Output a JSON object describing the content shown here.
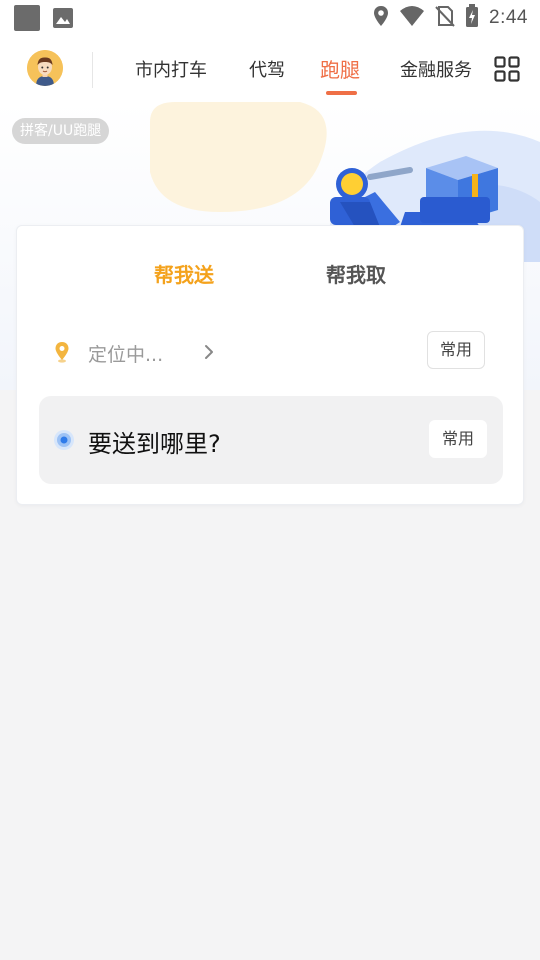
{
  "status_bar": {
    "left_icons": [
      "app-square-icon",
      "image-icon"
    ],
    "right_icons": [
      "location-icon",
      "wifi-icon",
      "no-sim-icon",
      "battery-icon"
    ],
    "time": "2:44"
  },
  "header": {
    "avatar_icon": "user-avatar-icon",
    "tabs": [
      {
        "label": "市内打车",
        "active": false
      },
      {
        "label": "代驾",
        "active": false
      },
      {
        "label": "跑腿",
        "active": true
      },
      {
        "label": "金融服务",
        "active": false
      }
    ],
    "menu_icon": "grid-menu-icon",
    "accent_color": "#ef6f46"
  },
  "banner": {
    "tag": "拼客/UU跑腿"
  },
  "card": {
    "tabs": [
      {
        "label": "帮我送",
        "active": true
      },
      {
        "label": "帮我取",
        "active": false
      }
    ],
    "active_color": "#f4a21c",
    "from": {
      "text": "定位中...",
      "button": "常用"
    },
    "to": {
      "text": "要送到哪里?",
      "button": "常用"
    }
  }
}
